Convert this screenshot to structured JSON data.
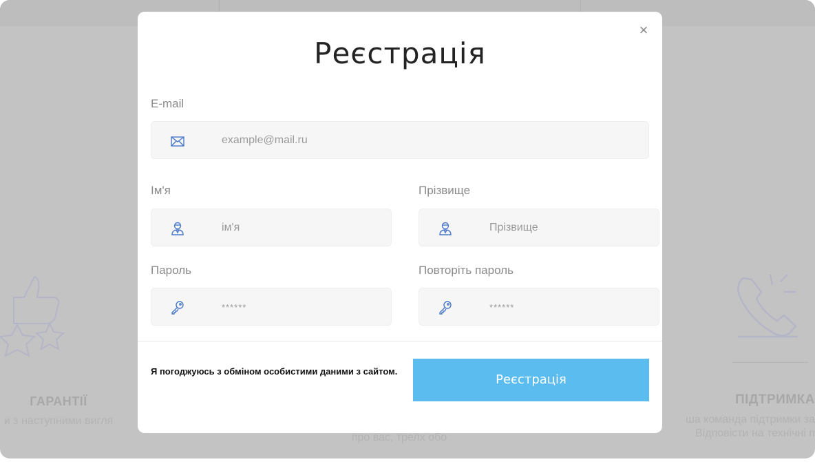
{
  "modal": {
    "title": "Реєстрація",
    "close_label": "×",
    "email_label": "E-mail",
    "email_placeholder": "example@mail.ru",
    "first_name_label": "Ім'я",
    "first_name_placeholder": "ім'я",
    "last_name_label": "Прізвище",
    "last_name_placeholder": "Прізвище",
    "password_label": "Пароль",
    "password_placeholder": "******",
    "password_repeat_label": "Повторіть пароль",
    "password_repeat_placeholder": "******",
    "agree_text": "Я погоджуюсь з обміном особистими даними з сайтом.",
    "submit_label": "Реєстрація",
    "accent_color": "#5bbcef"
  },
  "background": {
    "left_feature_title": "ГАРАНТІЇ",
    "left_feature_text": "и з наступними вигля",
    "center_feature_text": "про вас, трелх обо",
    "right_feature_title": "ПІДТРИМКА",
    "right_feature_text_1": "ша команда підтримки за",
    "right_feature_text_2": "Відповісти на технічні п",
    "icons": [
      "thumbs-up-stars-icon",
      "phone-icon"
    ]
  }
}
